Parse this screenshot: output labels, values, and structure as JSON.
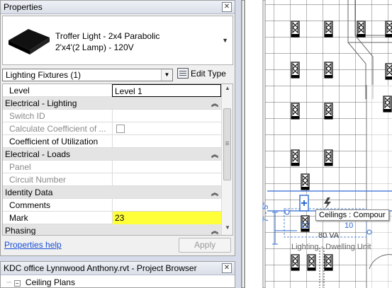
{
  "properties": {
    "title": "Properties",
    "family": "Troffer Light - 2x4 Parabolic",
    "type": "2'x4'(2 Lamp) - 120V",
    "category_selector": "Lighting Fixtures (1)",
    "edit_type": "Edit Type",
    "rows": [
      {
        "label": "Level",
        "value": "Level 1",
        "kind": "param"
      },
      {
        "label": "Electrical - Lighting",
        "value": "",
        "kind": "group"
      },
      {
        "label": "Switch ID",
        "value": "",
        "kind": "disabled"
      },
      {
        "label": "Calculate Coefficient of ...",
        "value": "",
        "kind": "disabled"
      },
      {
        "label": "Coefficient of Utilization",
        "value": "",
        "kind": "param"
      },
      {
        "label": "Electrical - Loads",
        "value": "",
        "kind": "group"
      },
      {
        "label": "Panel",
        "value": "",
        "kind": "disabled"
      },
      {
        "label": "Circuit Number",
        "value": "",
        "kind": "disabled"
      },
      {
        "label": "Identity Data",
        "value": "",
        "kind": "group"
      },
      {
        "label": "Comments",
        "value": "",
        "kind": "param"
      },
      {
        "label": "Mark",
        "value": "23",
        "kind": "param"
      },
      {
        "label": "Phasing",
        "value": "",
        "kind": "group"
      }
    ],
    "help_link": "Properties help",
    "apply_button": "Apply"
  },
  "project_browser": {
    "title": "KDC office Lynnwood Anthony.rvt - Project Browser",
    "tree_item": "Ceiling Plans"
  },
  "canvas": {
    "tooltip": "Ceilings : Compour",
    "tag_number": "12",
    "tag_text": "10",
    "va_label": "80 VA",
    "room_label": "Lighting - Dwelling Unit",
    "dim_text": "7' - 5\""
  },
  "colors": {
    "highlight": "#ffff3a",
    "link": "#1a4fd6",
    "selection": "#2d6bd2"
  }
}
